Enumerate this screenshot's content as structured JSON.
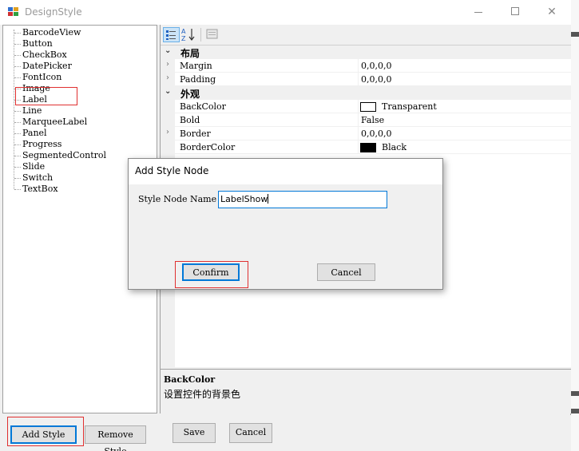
{
  "window": {
    "title": "DesignStyle",
    "icon": "app-grid-icon",
    "controls": [
      "minimize",
      "maximize",
      "close"
    ]
  },
  "tree": {
    "items": [
      "BarcodeView",
      "Button",
      "CheckBox",
      "DatePicker",
      "FontIcon",
      "Image",
      "Label",
      "Line",
      "MarqueeLabel",
      "Panel",
      "Progress",
      "SegmentedControl",
      "Slide",
      "Switch",
      "TextBox"
    ],
    "selected": "Label"
  },
  "toolbar": {
    "icons": [
      "categorized-icon",
      "alphabetical-sort-icon",
      "property-pages-icon"
    ]
  },
  "grid": {
    "categories": [
      {
        "label": "布局",
        "rows": [
          {
            "name": "Margin",
            "value": "0,0,0,0"
          },
          {
            "name": "Padding",
            "value": "0,0,0,0"
          }
        ]
      },
      {
        "label": "外观",
        "rows": [
          {
            "name": "BackColor",
            "value": "Transparent",
            "swatch": "#ffffff"
          },
          {
            "name": "Bold",
            "value": "False"
          },
          {
            "name": "Border",
            "value": "0,0,0,0"
          },
          {
            "name": "BorderColor",
            "value": "Black",
            "swatch": "#000000"
          }
        ]
      }
    ]
  },
  "description": {
    "title": "BackColor",
    "text": "设置控件的背景色"
  },
  "buttons": {
    "add_style": "Add Style",
    "remove_style": "Remove Style",
    "save": "Save",
    "cancel": "Cancel"
  },
  "dialog": {
    "title": "Add Style Node",
    "field_label": "Style Node Name",
    "field_value": "LabelShow",
    "confirm": "Confirm",
    "cancel": "Cancel"
  },
  "colors": {
    "accent": "#0078d7",
    "highlight_box": "#e03030"
  }
}
